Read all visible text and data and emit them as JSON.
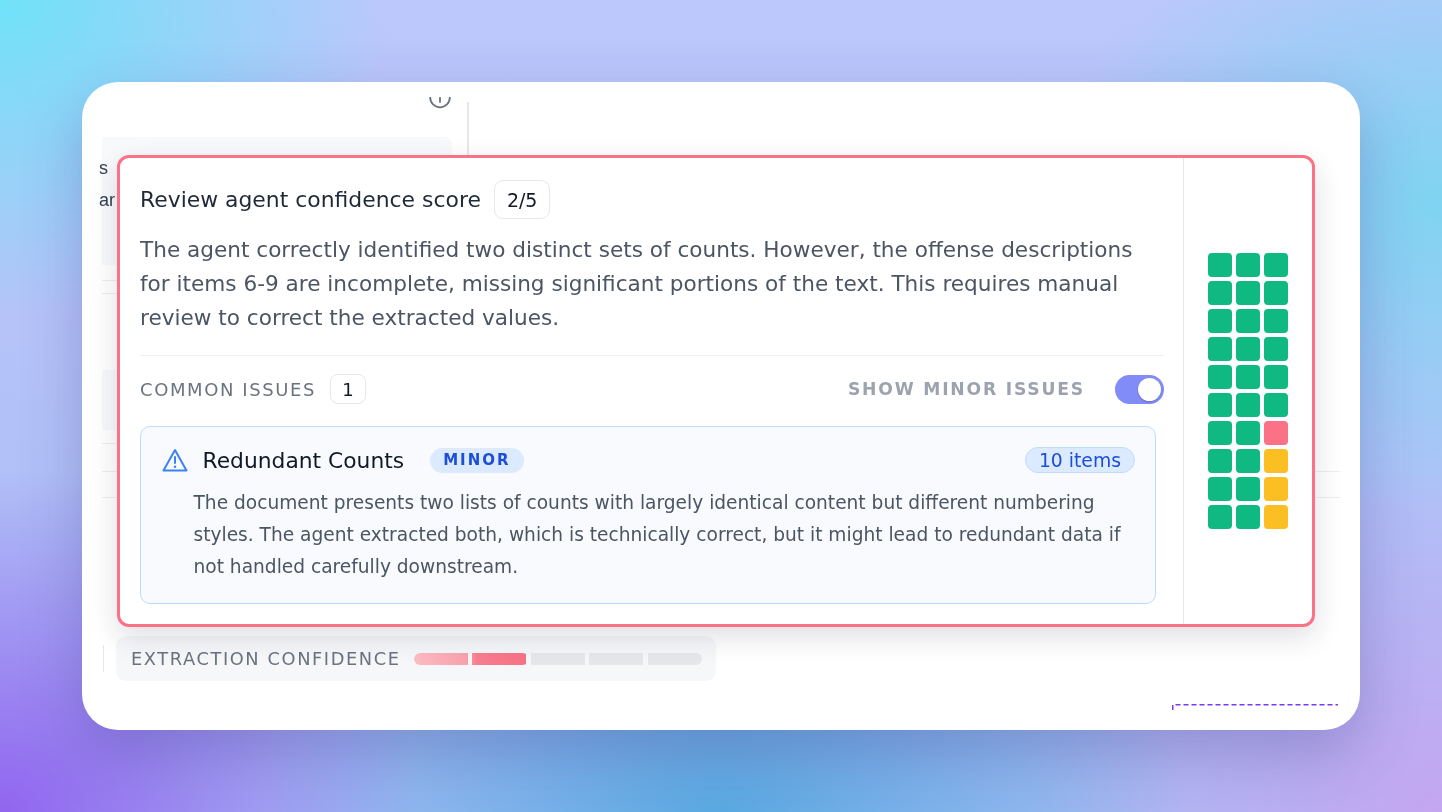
{
  "background_panel": {
    "text_lines": [
      "s",
      "ar"
    ]
  },
  "review": {
    "title": "Review agent confidence score",
    "score": "2/5",
    "summary": "The agent correctly identified two distinct sets of counts. However, the offense descriptions for items 6-9 are incomplete, missing significant portions of the text. This requires manual review to correct the extracted values.",
    "common_issues": {
      "label": "COMMON ISSUES",
      "count": "1"
    },
    "show_minor_toggle": {
      "label": "SHOW MINOR ISSUES",
      "on": true
    },
    "issues": [
      {
        "title": "Redundant Counts",
        "severity": "MINOR",
        "item_count": "10 items",
        "description": "The document presents two lists of counts with largely identical content but different numbering styles. The agent extracted both, which is technically correct, but it might lead to redundant data if not handled carefully downstream."
      }
    ],
    "confidence_grid": {
      "cells": [
        {
          "color": "#10b981"
        },
        {
          "color": "#10b981"
        },
        {
          "color": "#10b981"
        },
        {
          "color": "#10b981"
        },
        {
          "color": "#10b981"
        },
        {
          "color": "#10b981"
        },
        {
          "color": "#10b981"
        },
        {
          "color": "#10b981"
        },
        {
          "color": "#10b981"
        },
        {
          "color": "#10b981"
        },
        {
          "color": "#10b981"
        },
        {
          "color": "#10b981"
        },
        {
          "color": "#10b981"
        },
        {
          "color": "#10b981"
        },
        {
          "color": "#10b981"
        },
        {
          "color": "#10b981"
        },
        {
          "color": "#10b981"
        },
        {
          "color": "#10b981"
        },
        {
          "color": "#10b981"
        },
        {
          "color": "#10b981"
        },
        {
          "color": "#fb7185"
        },
        {
          "color": "#10b981"
        },
        {
          "color": "#10b981"
        },
        {
          "color": "#fbbf24"
        },
        {
          "color": "#10b981"
        },
        {
          "color": "#10b981"
        },
        {
          "color": "#fbbf24"
        },
        {
          "color": "#10b981"
        },
        {
          "color": "#10b981"
        },
        {
          "color": "#fbbf24"
        }
      ]
    }
  },
  "extraction_confidence": {
    "label": "EXTRACTION CONFIDENCE",
    "level": 0.4
  }
}
